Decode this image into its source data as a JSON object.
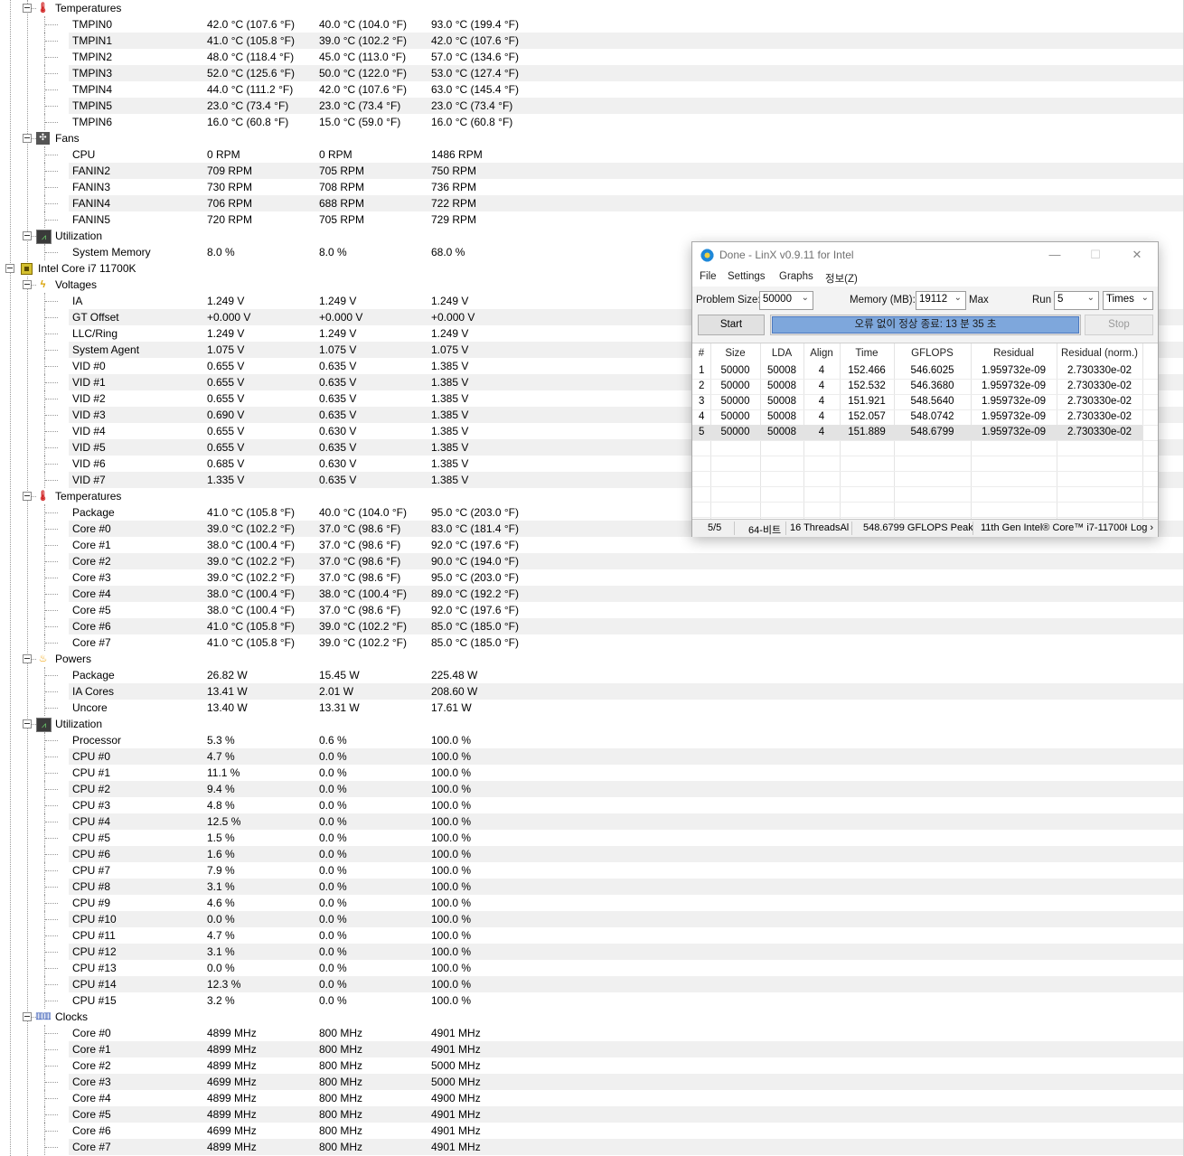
{
  "tree": {
    "rows": [
      {
        "type": "group",
        "label": "Temperatures",
        "icon": "thermometer-icon"
      },
      {
        "type": "item",
        "name": "TMPIN0",
        "v1": "42.0 °C  (107.6 °F)",
        "v2": "40.0 °C  (104.0 °F)",
        "v3": "93.0 °C  (199.4 °F)"
      },
      {
        "type": "item",
        "name": "TMPIN1",
        "v1": "41.0 °C  (105.8 °F)",
        "v2": "39.0 °C  (102.2 °F)",
        "v3": "42.0 °C  (107.6 °F)"
      },
      {
        "type": "item",
        "name": "TMPIN2",
        "v1": "48.0 °C  (118.4 °F)",
        "v2": "45.0 °C  (113.0 °F)",
        "v3": "57.0 °C  (134.6 °F)"
      },
      {
        "type": "item",
        "name": "TMPIN3",
        "v1": "52.0 °C  (125.6 °F)",
        "v2": "50.0 °C  (122.0 °F)",
        "v3": "53.0 °C  (127.4 °F)"
      },
      {
        "type": "item",
        "name": "TMPIN4",
        "v1": "44.0 °C  (111.2 °F)",
        "v2": "42.0 °C  (107.6 °F)",
        "v3": "63.0 °C  (145.4 °F)"
      },
      {
        "type": "item",
        "name": "TMPIN5",
        "v1": "23.0 °C  (73.4 °F)",
        "v2": "23.0 °C  (73.4 °F)",
        "v3": "23.0 °C  (73.4 °F)"
      },
      {
        "type": "item",
        "name": "TMPIN6",
        "v1": "16.0 °C  (60.8 °F)",
        "v2": "15.0 °C  (59.0 °F)",
        "v3": "16.0 °C  (60.8 °F)"
      },
      {
        "type": "group",
        "label": "Fans",
        "icon": "fan-icon"
      },
      {
        "type": "item",
        "name": "CPU",
        "v1": "0 RPM",
        "v2": "0 RPM",
        "v3": "1486 RPM"
      },
      {
        "type": "item",
        "name": "FANIN2",
        "v1": "709 RPM",
        "v2": "705 RPM",
        "v3": "750 RPM"
      },
      {
        "type": "item",
        "name": "FANIN3",
        "v1": "730 RPM",
        "v2": "708 RPM",
        "v3": "736 RPM"
      },
      {
        "type": "item",
        "name": "FANIN4",
        "v1": "706 RPM",
        "v2": "688 RPM",
        "v3": "722 RPM"
      },
      {
        "type": "item",
        "name": "FANIN5",
        "v1": "720 RPM",
        "v2": "705 RPM",
        "v3": "729 RPM"
      },
      {
        "type": "group",
        "label": "Utilization",
        "icon": "utilization-icon"
      },
      {
        "type": "item",
        "name": "System Memory",
        "v1": "8.0 %",
        "v2": "8.0 %",
        "v3": "68.0 %"
      },
      {
        "type": "hardware",
        "label": "Intel Core i7 11700K",
        "icon": "cpu-chip-icon"
      },
      {
        "type": "group",
        "label": "Voltages",
        "icon": "voltage-icon"
      },
      {
        "type": "item",
        "name": "IA",
        "v1": "1.249 V",
        "v2": "1.249 V",
        "v3": "1.249 V"
      },
      {
        "type": "item",
        "name": "GT Offset",
        "v1": "+0.000 V",
        "v2": "+0.000 V",
        "v3": "+0.000 V"
      },
      {
        "type": "item",
        "name": "LLC/Ring",
        "v1": "1.249 V",
        "v2": "1.249 V",
        "v3": "1.249 V"
      },
      {
        "type": "item",
        "name": "System Agent",
        "v1": "1.075 V",
        "v2": "1.075 V",
        "v3": "1.075 V"
      },
      {
        "type": "item",
        "name": "VID #0",
        "v1": "0.655 V",
        "v2": "0.635 V",
        "v3": "1.385 V"
      },
      {
        "type": "item",
        "name": "VID #1",
        "v1": "0.655 V",
        "v2": "0.635 V",
        "v3": "1.385 V"
      },
      {
        "type": "item",
        "name": "VID #2",
        "v1": "0.655 V",
        "v2": "0.635 V",
        "v3": "1.385 V"
      },
      {
        "type": "item",
        "name": "VID #3",
        "v1": "0.690 V",
        "v2": "0.635 V",
        "v3": "1.385 V"
      },
      {
        "type": "item",
        "name": "VID #4",
        "v1": "0.655 V",
        "v2": "0.630 V",
        "v3": "1.385 V"
      },
      {
        "type": "item",
        "name": "VID #5",
        "v1": "0.655 V",
        "v2": "0.635 V",
        "v3": "1.385 V"
      },
      {
        "type": "item",
        "name": "VID #6",
        "v1": "0.685 V",
        "v2": "0.630 V",
        "v3": "1.385 V"
      },
      {
        "type": "item",
        "name": "VID #7",
        "v1": "1.335 V",
        "v2": "0.635 V",
        "v3": "1.385 V"
      },
      {
        "type": "group",
        "label": "Temperatures",
        "icon": "thermometer-icon"
      },
      {
        "type": "item",
        "name": "Package",
        "v1": "41.0 °C  (105.8 °F)",
        "v2": "40.0 °C  (104.0 °F)",
        "v3": "95.0 °C  (203.0 °F)"
      },
      {
        "type": "item",
        "name": "Core #0",
        "v1": "39.0 °C  (102.2 °F)",
        "v2": "37.0 °C  (98.6 °F)",
        "v3": "83.0 °C  (181.4 °F)"
      },
      {
        "type": "item",
        "name": "Core #1",
        "v1": "38.0 °C  (100.4 °F)",
        "v2": "37.0 °C  (98.6 °F)",
        "v3": "92.0 °C  (197.6 °F)"
      },
      {
        "type": "item",
        "name": "Core #2",
        "v1": "39.0 °C  (102.2 °F)",
        "v2": "37.0 °C  (98.6 °F)",
        "v3": "90.0 °C  (194.0 °F)"
      },
      {
        "type": "item",
        "name": "Core #3",
        "v1": "39.0 °C  (102.2 °F)",
        "v2": "37.0 °C  (98.6 °F)",
        "v3": "95.0 °C  (203.0 °F)"
      },
      {
        "type": "item",
        "name": "Core #4",
        "v1": "38.0 °C  (100.4 °F)",
        "v2": "38.0 °C  (100.4 °F)",
        "v3": "89.0 °C  (192.2 °F)"
      },
      {
        "type": "item",
        "name": "Core #5",
        "v1": "38.0 °C  (100.4 °F)",
        "v2": "37.0 °C  (98.6 °F)",
        "v3": "92.0 °C  (197.6 °F)"
      },
      {
        "type": "item",
        "name": "Core #6",
        "v1": "41.0 °C  (105.8 °F)",
        "v2": "39.0 °C  (102.2 °F)",
        "v3": "85.0 °C  (185.0 °F)"
      },
      {
        "type": "item",
        "name": "Core #7",
        "v1": "41.0 °C  (105.8 °F)",
        "v2": "39.0 °C  (102.2 °F)",
        "v3": "85.0 °C  (185.0 °F)"
      },
      {
        "type": "group",
        "label": "Powers",
        "icon": "power-flame-icon"
      },
      {
        "type": "item",
        "name": "Package",
        "v1": "26.82 W",
        "v2": "15.45 W",
        "v3": "225.48 W"
      },
      {
        "type": "item",
        "name": "IA Cores",
        "v1": "13.41 W",
        "v2": "2.01 W",
        "v3": "208.60 W"
      },
      {
        "type": "item",
        "name": "Uncore",
        "v1": "13.40 W",
        "v2": "13.31 W",
        "v3": "17.61 W"
      },
      {
        "type": "group",
        "label": "Utilization",
        "icon": "utilization-icon"
      },
      {
        "type": "item",
        "name": "Processor",
        "v1": "5.3 %",
        "v2": "0.6 %",
        "v3": "100.0 %"
      },
      {
        "type": "item",
        "name": "CPU #0",
        "v1": "4.7 %",
        "v2": "0.0 %",
        "v3": "100.0 %"
      },
      {
        "type": "item",
        "name": "CPU #1",
        "v1": "11.1 %",
        "v2": "0.0 %",
        "v3": "100.0 %"
      },
      {
        "type": "item",
        "name": "CPU #2",
        "v1": "9.4 %",
        "v2": "0.0 %",
        "v3": "100.0 %"
      },
      {
        "type": "item",
        "name": "CPU #3",
        "v1": "4.8 %",
        "v2": "0.0 %",
        "v3": "100.0 %"
      },
      {
        "type": "item",
        "name": "CPU #4",
        "v1": "12.5 %",
        "v2": "0.0 %",
        "v3": "100.0 %"
      },
      {
        "type": "item",
        "name": "CPU #5",
        "v1": "1.5 %",
        "v2": "0.0 %",
        "v3": "100.0 %"
      },
      {
        "type": "item",
        "name": "CPU #6",
        "v1": "1.6 %",
        "v2": "0.0 %",
        "v3": "100.0 %"
      },
      {
        "type": "item",
        "name": "CPU #7",
        "v1": "7.9 %",
        "v2": "0.0 %",
        "v3": "100.0 %"
      },
      {
        "type": "item",
        "name": "CPU #8",
        "v1": "3.1 %",
        "v2": "0.0 %",
        "v3": "100.0 %"
      },
      {
        "type": "item",
        "name": "CPU #9",
        "v1": "4.6 %",
        "v2": "0.0 %",
        "v3": "100.0 %"
      },
      {
        "type": "item",
        "name": "CPU #10",
        "v1": "0.0 %",
        "v2": "0.0 %",
        "v3": "100.0 %"
      },
      {
        "type": "item",
        "name": "CPU #11",
        "v1": "4.7 %",
        "v2": "0.0 %",
        "v3": "100.0 %"
      },
      {
        "type": "item",
        "name": "CPU #12",
        "v1": "3.1 %",
        "v2": "0.0 %",
        "v3": "100.0 %"
      },
      {
        "type": "item",
        "name": "CPU #13",
        "v1": "0.0 %",
        "v2": "0.0 %",
        "v3": "100.0 %"
      },
      {
        "type": "item",
        "name": "CPU #14",
        "v1": "12.3 %",
        "v2": "0.0 %",
        "v3": "100.0 %"
      },
      {
        "type": "item",
        "name": "CPU #15",
        "v1": "3.2 %",
        "v2": "0.0 %",
        "v3": "100.0 %"
      },
      {
        "type": "group",
        "label": "Clocks",
        "icon": "clock-bars-icon"
      },
      {
        "type": "item",
        "name": "Core #0",
        "v1": "4899 MHz",
        "v2": "800 MHz",
        "v3": "4901 MHz"
      },
      {
        "type": "item",
        "name": "Core #1",
        "v1": "4899 MHz",
        "v2": "800 MHz",
        "v3": "4901 MHz"
      },
      {
        "type": "item",
        "name": "Core #2",
        "v1": "4899 MHz",
        "v2": "800 MHz",
        "v3": "5000 MHz"
      },
      {
        "type": "item",
        "name": "Core #3",
        "v1": "4699 MHz",
        "v2": "800 MHz",
        "v3": "5000 MHz"
      },
      {
        "type": "item",
        "name": "Core #4",
        "v1": "4899 MHz",
        "v2": "800 MHz",
        "v3": "4900 MHz"
      },
      {
        "type": "item",
        "name": "Core #5",
        "v1": "4899 MHz",
        "v2": "800 MHz",
        "v3": "4901 MHz"
      },
      {
        "type": "item",
        "name": "Core #6",
        "v1": "4699 MHz",
        "v2": "800 MHz",
        "v3": "4901 MHz"
      },
      {
        "type": "item",
        "name": "Core #7",
        "v1": "4899 MHz",
        "v2": "800 MHz",
        "v3": "4901 MHz"
      }
    ]
  },
  "linx": {
    "title": "Done - LinX v0.9.11 for Intel",
    "menu": [
      "File",
      "Settings",
      "Graphs",
      "정보(Z)"
    ],
    "problem_size_label": "Problem Size:",
    "problem_size": "50000",
    "memory_label": "Memory (MB):",
    "memory": "19112",
    "max_label": "Max",
    "run_label": "Run",
    "run": "5",
    "times": "Times",
    "start_label": "Start",
    "stop_label": "Stop",
    "progress_text": "오류 없이 정상 종료: 13 분 35 초",
    "progress_fraction": 1.0,
    "columns": [
      "#",
      "Size",
      "LDA",
      "Align",
      "Time",
      "GFLOPS",
      "Residual",
      "Residual (norm.)"
    ],
    "results": [
      [
        "1",
        "50000",
        "50008",
        "4",
        "152.466",
        "546.6025",
        "1.959732e-09",
        "2.730330e-02"
      ],
      [
        "2",
        "50000",
        "50008",
        "4",
        "152.532",
        "546.3680",
        "1.959732e-09",
        "2.730330e-02"
      ],
      [
        "3",
        "50000",
        "50008",
        "4",
        "151.921",
        "548.5640",
        "1.959732e-09",
        "2.730330e-02"
      ],
      [
        "4",
        "50000",
        "50008",
        "4",
        "152.057",
        "548.0742",
        "1.959732e-09",
        "2.730330e-02"
      ],
      [
        "5",
        "50000",
        "50008",
        "4",
        "151.889",
        "548.6799",
        "1.959732e-09",
        "2.730330e-02"
      ]
    ],
    "selected_row": 4,
    "status": {
      "progress": "5/5",
      "bits": "64-비트",
      "threads": "16 ThreadsAl",
      "peak": "548.6799 GFLOPS Peak",
      "cpu": "11th Gen Intel® Core™ i7-11700K",
      "log": "Log ›"
    }
  }
}
